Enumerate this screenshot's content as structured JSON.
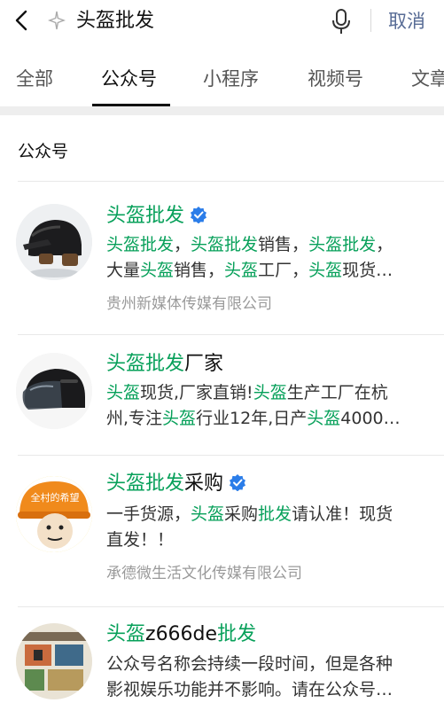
{
  "search": {
    "query": "头盔批发",
    "cancel_label": "取消"
  },
  "tabs": [
    {
      "label": "全部"
    },
    {
      "label": "公众号",
      "active": true
    },
    {
      "label": "小程序"
    },
    {
      "label": "视频号"
    },
    {
      "label": "文章"
    }
  ],
  "section": {
    "title": "公众号"
  },
  "colors": {
    "highlight": "#07a05a",
    "link": "#576b95",
    "verified": "#2b7de9"
  },
  "results": [
    {
      "avatar": "helmet-black-open-face",
      "verified": true,
      "name_parts": [
        {
          "t": "头盔批发",
          "hl": true
        }
      ],
      "desc_lines": [
        [
          {
            "t": "头盔批发",
            "hl": true
          },
          {
            "t": "，"
          },
          {
            "t": "头盔批发",
            "hl": true
          },
          {
            "t": "销售，"
          },
          {
            "t": "头盔批发",
            "hl": true
          },
          {
            "t": "，"
          }
        ],
        [
          {
            "t": "大量"
          },
          {
            "t": "头盔",
            "hl": true
          },
          {
            "t": "销售，"
          },
          {
            "t": "头盔",
            "hl": true
          },
          {
            "t": "工厂，"
          },
          {
            "t": "头盔",
            "hl": true
          },
          {
            "t": "现货…"
          }
        ]
      ],
      "company": "贵州新媒体传媒有限公司"
    },
    {
      "avatar": "helmet-visor",
      "verified": false,
      "name_parts": [
        {
          "t": "头盔批发",
          "hl": true
        },
        {
          "t": "厂家"
        }
      ],
      "desc_lines": [
        [
          {
            "t": "头盔",
            "hl": true
          },
          {
            "t": "现货,厂家直销!"
          },
          {
            "t": "头盔",
            "hl": true
          },
          {
            "t": "生产工厂在杭"
          }
        ],
        [
          {
            "t": "州,专注"
          },
          {
            "t": "头盔",
            "hl": true
          },
          {
            "t": "行业12年,日产"
          },
          {
            "t": "头盔",
            "hl": true
          },
          {
            "t": "4000…"
          }
        ]
      ],
      "company": ""
    },
    {
      "avatar": "cartoon-helmet-face",
      "avatar_text": "全村的希望",
      "verified": true,
      "name_parts": [
        {
          "t": "头盔批发",
          "hl": true
        },
        {
          "t": "采购"
        }
      ],
      "desc_lines": [
        [
          {
            "t": "一手货源，"
          },
          {
            "t": "头盔",
            "hl": true
          },
          {
            "t": "采购"
          },
          {
            "t": "批发",
            "hl": true
          },
          {
            "t": "请认准！现货"
          }
        ],
        [
          {
            "t": "直发！！"
          }
        ]
      ],
      "company": "承德微生活文化传媒有限公司"
    },
    {
      "avatar": "film-collage",
      "verified": false,
      "name_parts": [
        {
          "t": "头盔",
          "hl": true
        },
        {
          "t": "z666de"
        },
        {
          "t": "批发",
          "hl": true
        }
      ],
      "desc_lines": [
        [
          {
            "t": "公众号名称会持续一段时间，但是各种"
          }
        ],
        [
          {
            "t": "影视娱乐功能并不影响。请在公众号…"
          }
        ]
      ],
      "company": ""
    }
  ]
}
